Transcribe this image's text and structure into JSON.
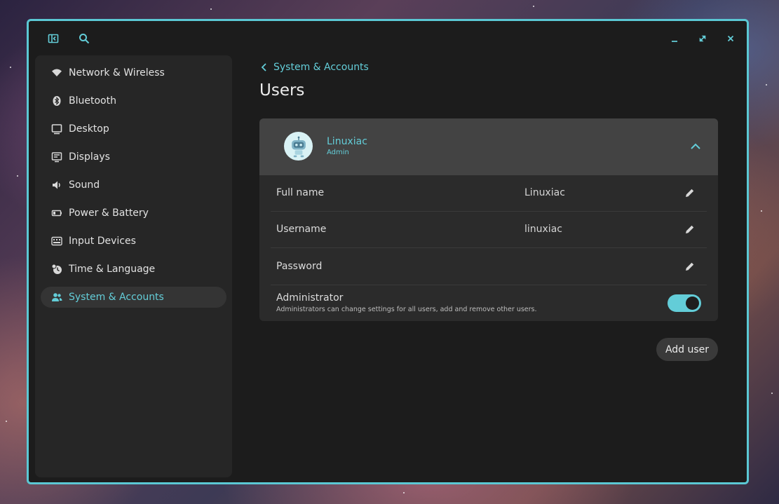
{
  "window": {
    "accent": "#5bc8d4",
    "titlebar_icons": [
      "sidebar-toggle-icon",
      "search-icon"
    ],
    "controls": [
      "minimize-icon",
      "maximize-icon",
      "close-icon"
    ]
  },
  "sidebar": {
    "items": [
      {
        "label": "Network & Wireless",
        "icon": "wifi-icon"
      },
      {
        "label": "Bluetooth",
        "icon": "bluetooth-icon"
      },
      {
        "label": "Desktop",
        "icon": "desktop-icon"
      },
      {
        "label": "Displays",
        "icon": "display-icon"
      },
      {
        "label": "Sound",
        "icon": "speaker-icon"
      },
      {
        "label": "Power & Battery",
        "icon": "battery-icon"
      },
      {
        "label": "Input Devices",
        "icon": "keyboard-icon"
      },
      {
        "label": "Time & Language",
        "icon": "clock-globe-icon"
      },
      {
        "label": "System & Accounts",
        "icon": "users-icon",
        "active": true
      }
    ]
  },
  "main": {
    "breadcrumb": "System & Accounts",
    "title": "Users",
    "user": {
      "name": "Linuxiac",
      "role": "Admin",
      "avatar_icon": "robot-avatar-icon"
    },
    "rows": [
      {
        "label": "Full name",
        "value": "Linuxiac"
      },
      {
        "label": "Username",
        "value": "linuxiac"
      },
      {
        "label": "Password",
        "value": ""
      }
    ],
    "administrator": {
      "label": "Administrator",
      "description": "Administrators can change settings for all users, add and remove other users.",
      "enabled": true
    },
    "add_user_label": "Add user"
  }
}
